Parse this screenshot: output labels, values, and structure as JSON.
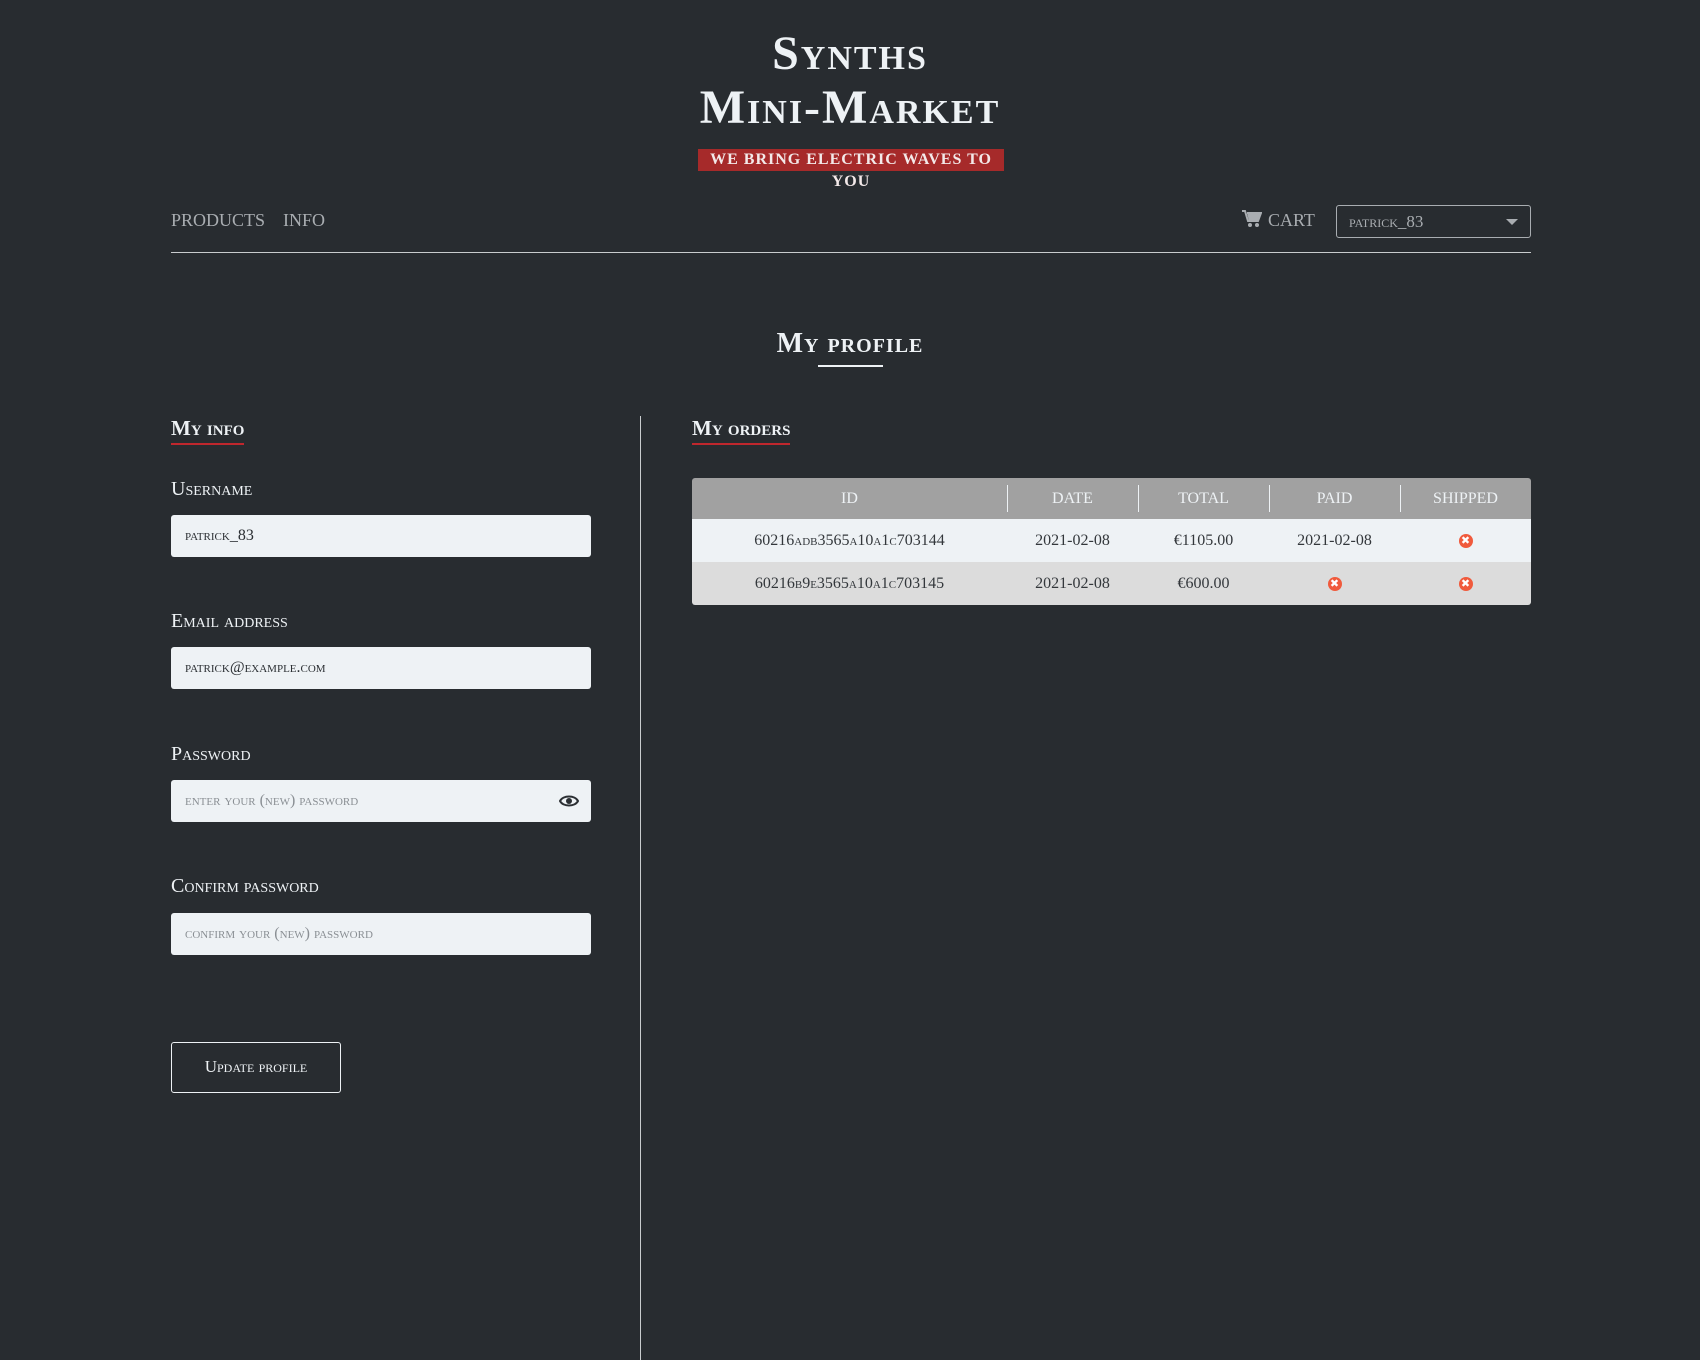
{
  "header": {
    "title_line1": "Synths",
    "title_line2": "Mini-Market",
    "tagline": "We bring electric waves to you"
  },
  "nav": {
    "products": "Products",
    "info": "Info",
    "cart": "Cart",
    "user": "patrick_83"
  },
  "page_title": "My profile",
  "info": {
    "heading": "My info",
    "username_label": "Username",
    "username_value": "patrick_83",
    "email_label": "Email address",
    "email_value": "patrick@example.com",
    "password_label": "Password",
    "password_placeholder": "Enter your (new) password",
    "confirm_label": "Confirm password",
    "confirm_placeholder": "Confirm your (new) password",
    "update_button": "Update profile"
  },
  "orders": {
    "heading": "My orders",
    "columns": [
      "ID",
      "Date",
      "Total",
      "Paid",
      "Shipped"
    ],
    "rows": [
      {
        "id": "60216adb3565a10a1c703144",
        "date": "2021-02-08",
        "total": "€1105.00",
        "paid": "2021-02-08",
        "shipped": "✖"
      },
      {
        "id": "60216b9e3565a10a1c703145",
        "date": "2021-02-08",
        "total": "€600.00",
        "paid": "✖",
        "shipped": "✖"
      }
    ]
  },
  "colors": {
    "accent": "#c0272d",
    "banner": "#a62a2a",
    "background": "#282c30",
    "status_no": "#f05a3c"
  }
}
